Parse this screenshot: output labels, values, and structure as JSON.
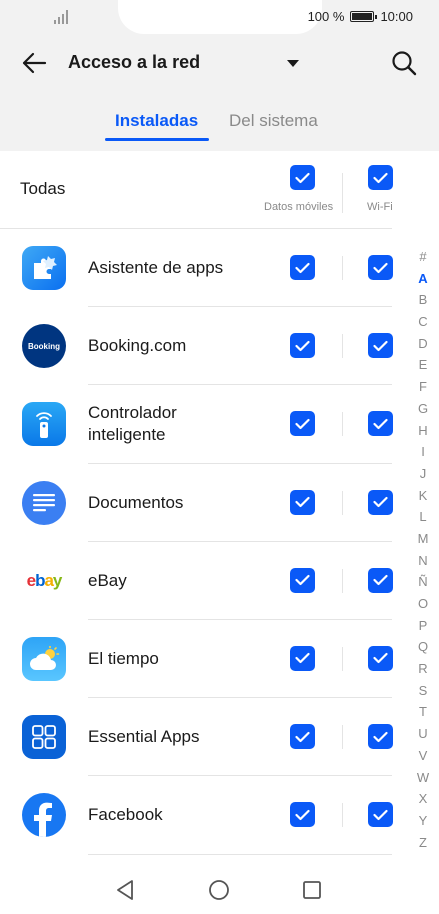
{
  "status_bar": {
    "battery_percent": "100 %",
    "time": "10:00"
  },
  "header": {
    "title": "Acceso a la red"
  },
  "tabs": [
    {
      "label": "Instaladas",
      "active": true
    },
    {
      "label": "Del sistema",
      "active": false
    }
  ],
  "all_row": {
    "label": "Todas",
    "data_label": "Datos móviles",
    "wifi_label": "Wi-Fi",
    "data_checked": true,
    "wifi_checked": true
  },
  "apps": [
    {
      "name": "Asistente de apps",
      "data_checked": true,
      "wifi_checked": true
    },
    {
      "name": "Booking.com",
      "logo_text": "Booking",
      "data_checked": true,
      "wifi_checked": true
    },
    {
      "name": "Controlador inteligente",
      "data_checked": true,
      "wifi_checked": true
    },
    {
      "name": "Documentos",
      "data_checked": true,
      "wifi_checked": true
    },
    {
      "name": "eBay",
      "logo_text": [
        "e",
        "b",
        "a",
        "y"
      ],
      "data_checked": true,
      "wifi_checked": true
    },
    {
      "name": "El tiempo",
      "data_checked": true,
      "wifi_checked": true
    },
    {
      "name": "Essential Apps",
      "data_checked": true,
      "wifi_checked": true
    },
    {
      "name": "Facebook",
      "data_checked": true,
      "wifi_checked": true
    }
  ],
  "alpha_index": [
    "#",
    "A",
    "B",
    "C",
    "D",
    "E",
    "F",
    "G",
    "H",
    "I",
    "J",
    "K",
    "L",
    "M",
    "N",
    "Ñ",
    "O",
    "P",
    "Q",
    "R",
    "S",
    "T",
    "U",
    "V",
    "W",
    "X",
    "Y",
    "Z"
  ],
  "alpha_active": "A",
  "colors": {
    "accent": "#0a59f7",
    "header_bg": "#f2f2f2",
    "inactive_text": "#8a8a8a"
  }
}
